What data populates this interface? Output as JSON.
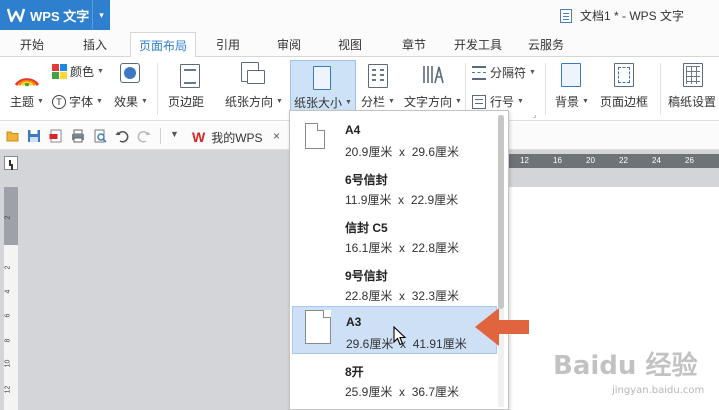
{
  "app": {
    "name": "WPS 文字",
    "logo": "W",
    "menu_arrow": "▾"
  },
  "window": {
    "title": "文档1 * - WPS 文字"
  },
  "tabs": [
    "开始",
    "插入",
    "页面布局",
    "引用",
    "审阅",
    "视图",
    "章节",
    "开发工具",
    "云服务"
  ],
  "active_tab": "页面布局",
  "ribbon": {
    "theme": "主题",
    "color": "颜色",
    "font": "字体",
    "effect": "效果",
    "margins": "页边距",
    "orientation": "纸张方向",
    "paper_size": "纸张大小",
    "columns": "分栏",
    "text_direction": "文字方向",
    "separator": "分隔符",
    "line_number": "行号",
    "background": "背景",
    "page_border": "页面边框",
    "manuscript": "稿纸设置"
  },
  "doc_tab": {
    "label": "我的WPS",
    "close": "×"
  },
  "ruler": {
    "horizontal": [
      "12",
      "16",
      "20",
      "22",
      "24",
      "26"
    ],
    "vertical": [
      "2",
      "2",
      "4",
      "6",
      "8",
      "10",
      "12"
    ]
  },
  "paper_sizes": [
    {
      "name": "A4",
      "width": "20.9厘米",
      "height": "29.6厘米"
    },
    {
      "name": "6号信封",
      "width": "11.9厘米",
      "height": "22.9厘米"
    },
    {
      "name": "信封 C5",
      "width": "16.1厘米",
      "height": "22.8厘米"
    },
    {
      "name": "9号信封",
      "width": "22.8厘米",
      "height": "32.3厘米"
    },
    {
      "name": "A3",
      "width": "29.6厘米",
      "height": "41.91厘米"
    },
    {
      "name": "8开",
      "width": "25.9厘米",
      "height": "36.7厘米"
    }
  ],
  "dim_separator": "x",
  "hovered_paper": "A3",
  "watermark": {
    "text": "Baidu 经验",
    "url": "jingyan.baidu.com"
  },
  "colors": {
    "accent": "#2f7fcf",
    "highlight": "#cde0f5",
    "arrow": "#e0643e"
  }
}
